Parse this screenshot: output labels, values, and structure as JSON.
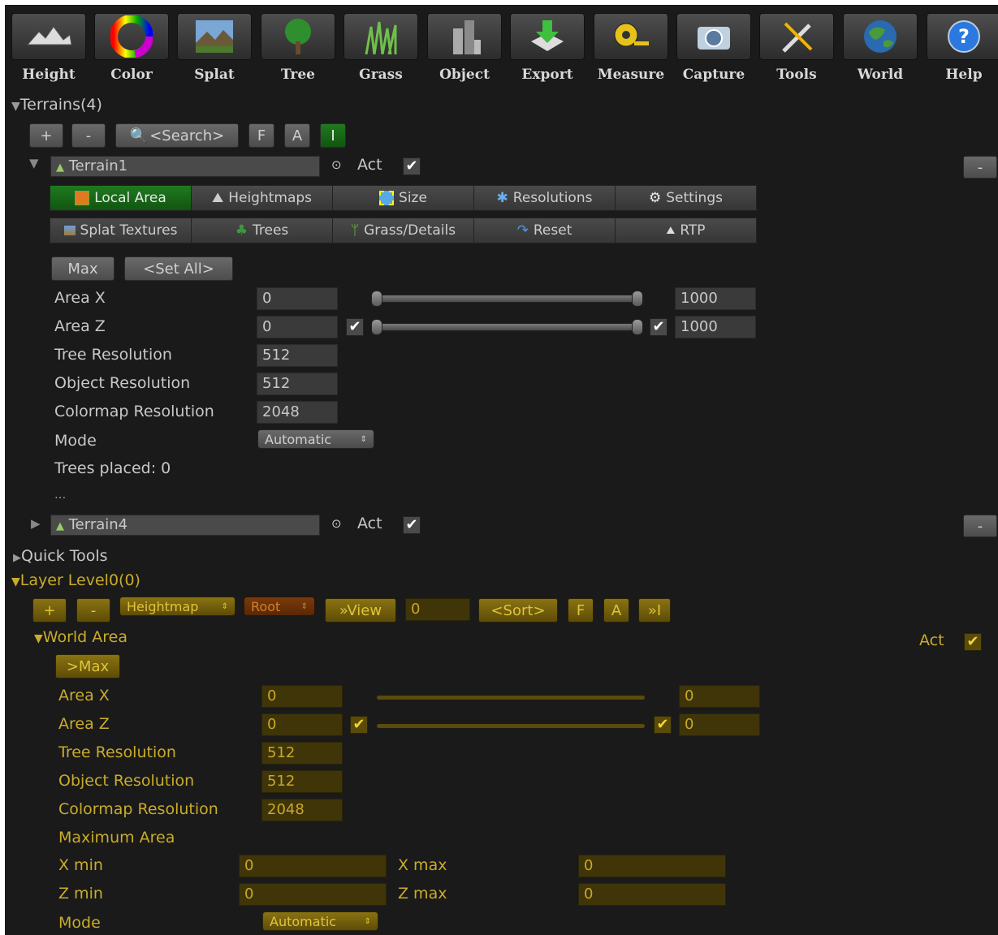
{
  "toolbar": [
    {
      "label": "Height",
      "icon": "terrain-height-icon"
    },
    {
      "label": "Color",
      "icon": "color-wheel-icon"
    },
    {
      "label": "Splat",
      "icon": "splat-landscape-icon"
    },
    {
      "label": "Tree",
      "icon": "tree-icon"
    },
    {
      "label": "Grass",
      "icon": "grass-icon"
    },
    {
      "label": "Object",
      "icon": "object-buildings-icon"
    },
    {
      "label": "Export",
      "icon": "export-download-icon"
    },
    {
      "label": "Measure",
      "icon": "measure-tape-icon"
    },
    {
      "label": "Capture",
      "icon": "camera-icon"
    },
    {
      "label": "Tools",
      "icon": "tools-wrench-icon"
    },
    {
      "label": "World",
      "icon": "globe-icon"
    },
    {
      "label": "Help",
      "icon": "help-icon"
    }
  ],
  "terrains": {
    "header": "Terrains(4)",
    "add": "+",
    "remove": "-",
    "search": "<Search>",
    "f": "F",
    "a": "A",
    "i": "I",
    "terrain1": {
      "name": "Terrain1",
      "act": "Act",
      "minus": "-"
    },
    "tabs_row1": [
      "Local Area",
      "Heightmaps",
      "Size",
      "Resolutions",
      "Settings"
    ],
    "tabs_row2": [
      "Splat Textures",
      "Trees",
      "Grass/Details",
      "Reset",
      "RTP"
    ],
    "max": "Max",
    "set_all": "<Set All>",
    "area_x": {
      "label": "Area X",
      "min": "0",
      "max": "1000"
    },
    "area_z": {
      "label": "Area Z",
      "min": "0",
      "max": "1000"
    },
    "tree_res": {
      "label": "Tree Resolution",
      "value": "512"
    },
    "object_res": {
      "label": "Object Resolution",
      "value": "512"
    },
    "colormap_res": {
      "label": "Colormap Resolution",
      "value": "2048"
    },
    "mode": {
      "label": "Mode",
      "value": "Automatic"
    },
    "trees_placed": "Trees placed: 0",
    "ellipsis": "...",
    "terrain4": {
      "name": "Terrain4",
      "act": "Act",
      "minus": "-"
    }
  },
  "quick_tools": "Quick Tools",
  "layer": {
    "header": "Layer Level0(0)",
    "add": "+",
    "remove": "-",
    "heightmap": "Heightmap",
    "root": "Root",
    "view": "»View",
    "view_value": "0",
    "sort": "<Sort>",
    "f": "F",
    "a": "A",
    "i": "»I",
    "world_area": "World Area",
    "act": "Act",
    "max": ">Max",
    "area_x": {
      "label": "Area X",
      "min": "0",
      "max": "0"
    },
    "area_z": {
      "label": "Area Z",
      "min": "0",
      "max": "0"
    },
    "tree_res": {
      "label": "Tree Resolution",
      "value": "512"
    },
    "object_res": {
      "label": "Object Resolution",
      "value": "512"
    },
    "colormap_res": {
      "label": "Colormap Resolution",
      "value": "2048"
    },
    "maximum_area": "Maximum Area",
    "xmin": {
      "label": "X min",
      "value": "0"
    },
    "xmax": {
      "label": "X max",
      "value": "0"
    },
    "zmin": {
      "label": "Z min",
      "value": "0"
    },
    "zmax": {
      "label": "Z max",
      "value": "0"
    },
    "mode": {
      "label": "Mode",
      "value": "Automatic"
    }
  },
  "colors": {
    "bg": "#1a1a1a",
    "accent_yellow": "#c9ac2a",
    "active_green": "#1f7a1f"
  }
}
